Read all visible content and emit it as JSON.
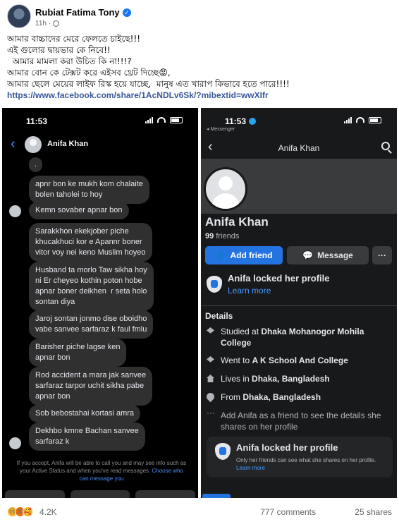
{
  "post": {
    "author": "Rubiat Fatima Tony",
    "time": "11h",
    "lines": [
      "আমার বাচ্চাদের মেরে ফেলতে চাইছে!!!",
      "এই গুলোর দ্বায়ভার কে নিবে!!",
      "  আমার মামলা করা উচিত কি না!!!?",
      "আমার বোন কে টেক্সট করে এইসব থ্রেট দিচ্ছে😡,",
      "আমার ছেলে মেয়ের লাইফ রিস্ক হয়ে যাচ্ছে,  মানুষ এত খারাপ কিভাবে হতে পারে!!!!"
    ],
    "link": "https://www.facebook.com/share/1AcNDLv6Sk/?mibextid=wwXIfr"
  },
  "left_screen": {
    "time": "11:53",
    "contact_name": "Anifa Khan",
    "messages": [
      ".",
      "apnr bon ke mukh kom chalaite\nbolen taholei to hoy",
      "Kemn sovaber apnar bon",
      "Sarakkhon ekekjober piche\nkhucakhuci kor e Apannr boner\nvitor voy nei keno Muslim hoyeo",
      "Husband ta morlo Taw sikha hoy\nni Er cheyeo kothin poton hobe\napnar boner deikhen  r seta holo\nsontan diya",
      "Jaroj sontan jonmo dise oboidho\nvabe sanvee sarfaraz k faul fmlu",
      "Barisher piche lagse ken\napnar bon",
      "Rod accident a mara jak sanvee\nsarfaraz tarpor uchit sikha pabe\napnar bon",
      "Sob bebostahai kortasi amra",
      "Dekhbo kmne Bachan sanvee\nsarfaraz k"
    ],
    "footer_text": "If you accept, Anifa will be able to call you and may see info such as your Active Status and when you've read messages.",
    "footer_link": "Choose who can message you"
  },
  "right_screen": {
    "time": "11:53",
    "app_back": "◂ Messenger",
    "title": "Anifa Khan",
    "name": "Anifa Khan",
    "friends_count": "99",
    "friends_label": "friends",
    "add_friend": "Add friend",
    "message": "Message",
    "more": "···",
    "locked_title": "Anifa locked her profile",
    "learn_more": "Learn more",
    "details_header": "Details",
    "details": [
      {
        "prefix": "Studied at ",
        "bold": "Dhaka Mohanogor Mohila College"
      },
      {
        "prefix": "Went to ",
        "bold": "A K School And College"
      },
      {
        "prefix": "Lives in ",
        "bold": "Dhaka, Bangladesh"
      },
      {
        "prefix": "From ",
        "bold": "Dhaka, Bangladesh"
      },
      {
        "prefix": "Add Anifa as a friend to see the details she shares on her profile",
        "bold": ""
      }
    ],
    "card_title": "Anifa locked her profile",
    "card_text": "Only her friends can see what she shares on her profile.",
    "card_link": "Learn more"
  },
  "footer": {
    "reactions_count": "4.2K",
    "comments": "777 comments",
    "shares": "25 shares"
  }
}
